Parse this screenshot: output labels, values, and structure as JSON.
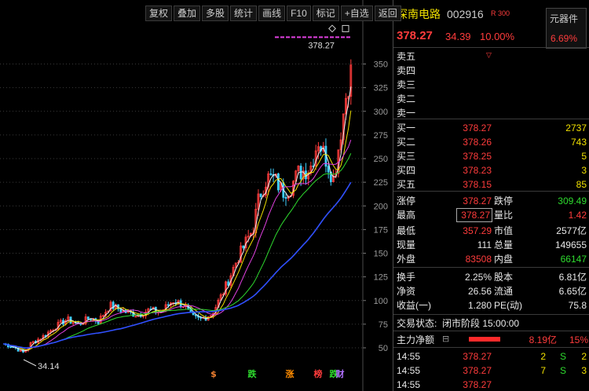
{
  "toolbar": [
    "复权",
    "叠加",
    "多股",
    "统计",
    "画线",
    "F10",
    "标记",
    "+自选",
    "返回"
  ],
  "chart_data": {
    "type": "candlestick",
    "y_ticks": [
      50,
      75,
      100,
      125,
      150,
      175,
      200,
      225,
      250,
      275,
      300,
      325,
      350
    ],
    "price_labels": {
      "high": "378.27",
      "low": "34.14"
    },
    "markers": [
      {
        "text": "$",
        "color": "#f08030"
      },
      {
        "text": "跌",
        "color": "#2edb2e"
      },
      {
        "text": "涨",
        "color": "#ff8c00"
      },
      {
        "text": "榜",
        "color": "#ff3c3c"
      },
      {
        "text": "跌",
        "color": "#2edb2e"
      },
      {
        "text": "财",
        "color": "#b070ff"
      }
    ],
    "ma_colors": [
      "#f0f0f0",
      "#f0e000",
      "#e040e0",
      "#2edb2e",
      "#3050ff"
    ],
    "high_line_color": "#e040e0",
    "candle_up_color": "#ff3c3c",
    "candle_down_color": "#40d0ff"
  },
  "stock": {
    "name": "深南电路",
    "code": "002916",
    "badge": "R 300",
    "price": "378.27",
    "change": "34.39",
    "change_pct": "10.00%",
    "sector": "元器件",
    "sector_pct": "6.69%"
  },
  "sell_orders": [
    {
      "label": "卖五"
    },
    {
      "label": "卖四"
    },
    {
      "label": "卖三"
    },
    {
      "label": "卖二"
    },
    {
      "label": "卖一"
    }
  ],
  "buy_orders": [
    {
      "label": "买一",
      "price": "378.27",
      "vol": "2737"
    },
    {
      "label": "买二",
      "price": "378.26",
      "vol": "743"
    },
    {
      "label": "买三",
      "price": "378.25",
      "vol": "5"
    },
    {
      "label": "买四",
      "price": "378.23",
      "vol": "3"
    },
    {
      "label": "买五",
      "price": "378.15",
      "vol": "85"
    }
  ],
  "stats": {
    "limit_up_label": "涨停",
    "limit_up": "378.27",
    "limit_down_label": "跌停",
    "limit_down": "309.49",
    "high_label": "最高",
    "high": "378.27",
    "vol_ratio_label": "量比",
    "vol_ratio": "1.42",
    "low_label": "最低",
    "low": "357.29",
    "mktcap_label": "市值",
    "mktcap": "2577亿",
    "cur_vol_label": "现量",
    "cur_vol": "111",
    "total_vol_label": "总量",
    "total_vol": "149655",
    "outer_label": "外盘",
    "outer": "83508",
    "inner_label": "内盘",
    "inner": "66147",
    "turnover_label": "换手",
    "turnover": "2.25%",
    "shares_label": "股本",
    "shares": "6.81亿",
    "nav_label": "净资",
    "nav": "26.56",
    "float_label": "流通",
    "float": "6.65亿",
    "eps_label": "收益(一)",
    "eps": "1.280",
    "pe_label": "PE(动)",
    "pe": "75.8"
  },
  "trade_status": {
    "label": "交易状态:",
    "value": "闭市阶段 15:00:00"
  },
  "main_flow": {
    "label": "主力净额",
    "value": "8.19亿",
    "pct": "15%"
  },
  "ticks": [
    {
      "time": "14:55",
      "price": "378.27",
      "vol": "2",
      "side": "S",
      "last": "2"
    },
    {
      "time": "14:55",
      "price": "378.27",
      "vol": "7",
      "side": "S",
      "last": "3"
    },
    {
      "time": "14:55",
      "price": "378.27",
      "vol": "",
      "side": "",
      "last": ""
    }
  ]
}
